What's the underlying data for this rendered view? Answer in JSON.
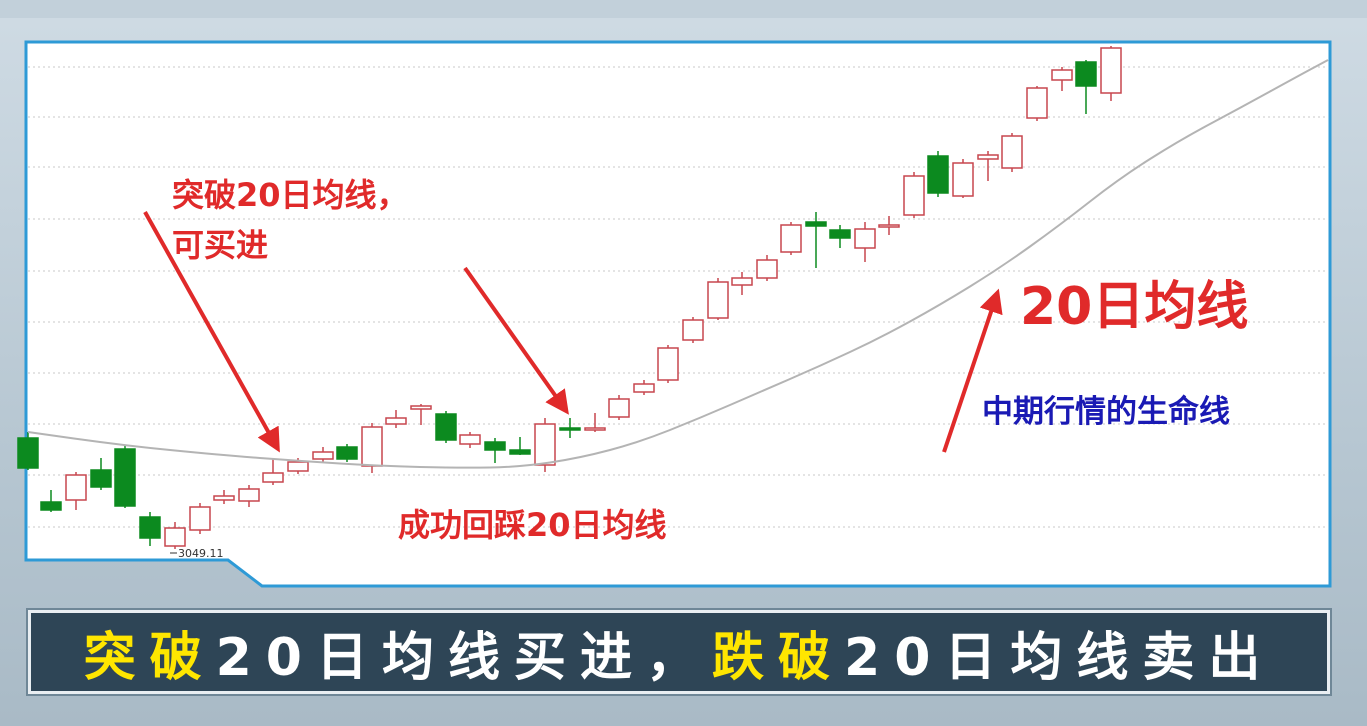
{
  "chart_data": {
    "type": "candlestick",
    "ma_label": "20日均线",
    "price_annotation": "3049.11",
    "annotations": {
      "breakout": [
        "突破20日均线，",
        "可买进"
      ],
      "pullback": "成功回踩20日均线",
      "ma_title": "20日均线",
      "ma_subtitle": "中期行情的生命线"
    },
    "colors": {
      "up": "#c7464e",
      "down": "#0c8a1f",
      "ma_line": "#b4b4b4",
      "annotation_red": "#e02a2a",
      "annotation_blue": "#1a1ab4",
      "grid": "#c8c8c8"
    }
  },
  "caption": {
    "seg1": "突破",
    "seg2": "20日均线买进，",
    "seg3": "跌破",
    "seg4": "20日均线卖出"
  }
}
